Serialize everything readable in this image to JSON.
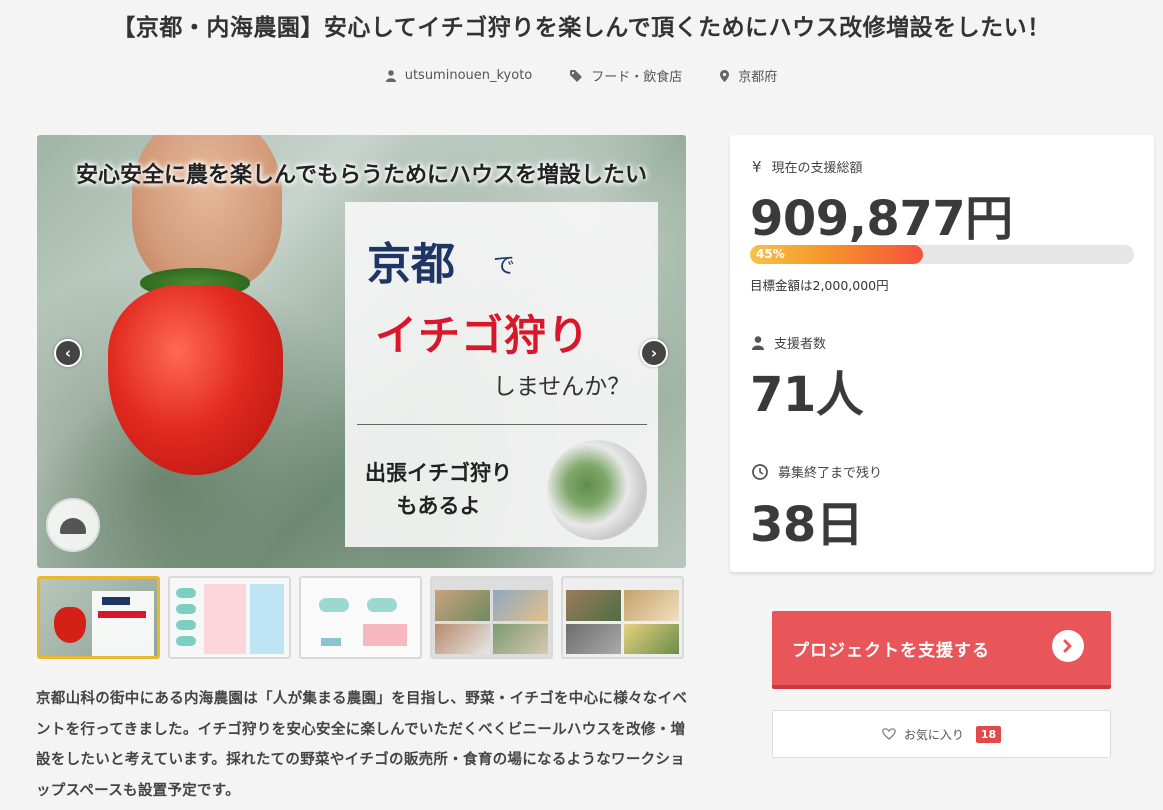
{
  "project": {
    "title": "【京都・内海農園】安心してイチゴ狩りを楽しんで頂くためにハウス改修増設をしたい！",
    "owner": "utsuminouen_kyoto",
    "category": "フード・飲食店",
    "location": "京都府"
  },
  "main_image": {
    "headline": "安心安全に農を楽しんでもらうためにハウスを増設したい",
    "panel_kyoto": "京都",
    "panel_de": "で",
    "panel_ichigo": "イチゴ狩り",
    "panel_shimasenka": "しませんか？",
    "panel_shucho_line1": "出張イチゴ狩り",
    "panel_shucho_line2": "もあるよ",
    "prev_icon": "chevron-left-icon",
    "next_icon": "chevron-right-icon"
  },
  "thumbnails": [
    {
      "id": "thumb-1",
      "active": true
    },
    {
      "id": "thumb-2",
      "active": false
    },
    {
      "id": "thumb-3",
      "active": false
    },
    {
      "id": "thumb-4",
      "active": false
    },
    {
      "id": "thumb-5",
      "active": false
    }
  ],
  "description": "京都山科の街中にある内海農園は「人が集まる農園」を目指し、野菜・イチゴを中心に様々なイベントを行ってきました。イチゴ狩りを安心安全に楽しんでいただくべくビニールハウスを改修・増設をしたいと考えています。採れたての野菜やイチゴの販売所・食育の場になるようなワークショップスペースも設置予定です。",
  "stats": {
    "funding_label": "現在の支援総額",
    "funding_icon_glyph": "¥",
    "funding_amount": "909,877円",
    "progress_percent": 45,
    "progress_text": "45%",
    "goal_text": "目標金額は2,000,000円",
    "supporters_label": "支援者数",
    "supporters_value": "71人",
    "remaining_label": "募集終了まで残り",
    "remaining_value": "38日"
  },
  "actions": {
    "support_label": "プロジェクトを支援する",
    "favorite_label": "お気に入り",
    "favorite_count": "18"
  },
  "colors": {
    "accent": "#e8565a",
    "progress_start": "#f6c24a",
    "progress_end": "#f4523c",
    "thumb_active_border": "#e8b830"
  }
}
